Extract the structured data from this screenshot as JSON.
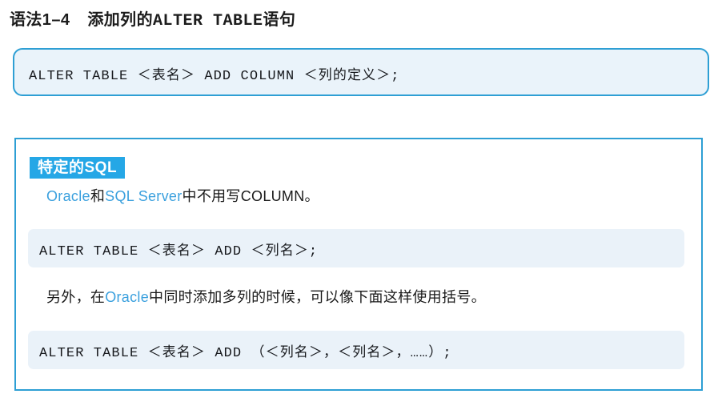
{
  "title": {
    "label_prefix": "语法1–4",
    "label_main": "添加列的",
    "label_mono": "ALTER TABLE",
    "label_suffix": "语句"
  },
  "syntax_block": {
    "code": "ALTER TABLE ＜表名＞ ADD COLUMN ＜列的定义＞;"
  },
  "sql_panel": {
    "badge": "特定的SQL",
    "paragraph_1": {
      "accent_1": "Oracle",
      "text_1": "和",
      "accent_2": "SQL Server",
      "text_2": "中不用写COLUMN。"
    },
    "code_block_1": {
      "code": "ALTER TABLE ＜表名＞ ADD ＜列名＞;"
    },
    "paragraph_2": {
      "text_1": "另外，在",
      "accent_1": "Oracle",
      "text_2": "中同时添加多列的时候，可以像下面这样使用括号。"
    },
    "code_block_2": {
      "code": "ALTER TABLE ＜表名＞ ADD （＜列名＞，＜列名＞，……）;"
    }
  },
  "colors": {
    "accent_blue": "#3aa0de",
    "border_blue": "#2e9fd4",
    "badge_blue": "#25a7e6",
    "code_bg": "#eaf2f9",
    "syntax_bg": "#eaf3fa",
    "text": "#1a1a1a"
  }
}
